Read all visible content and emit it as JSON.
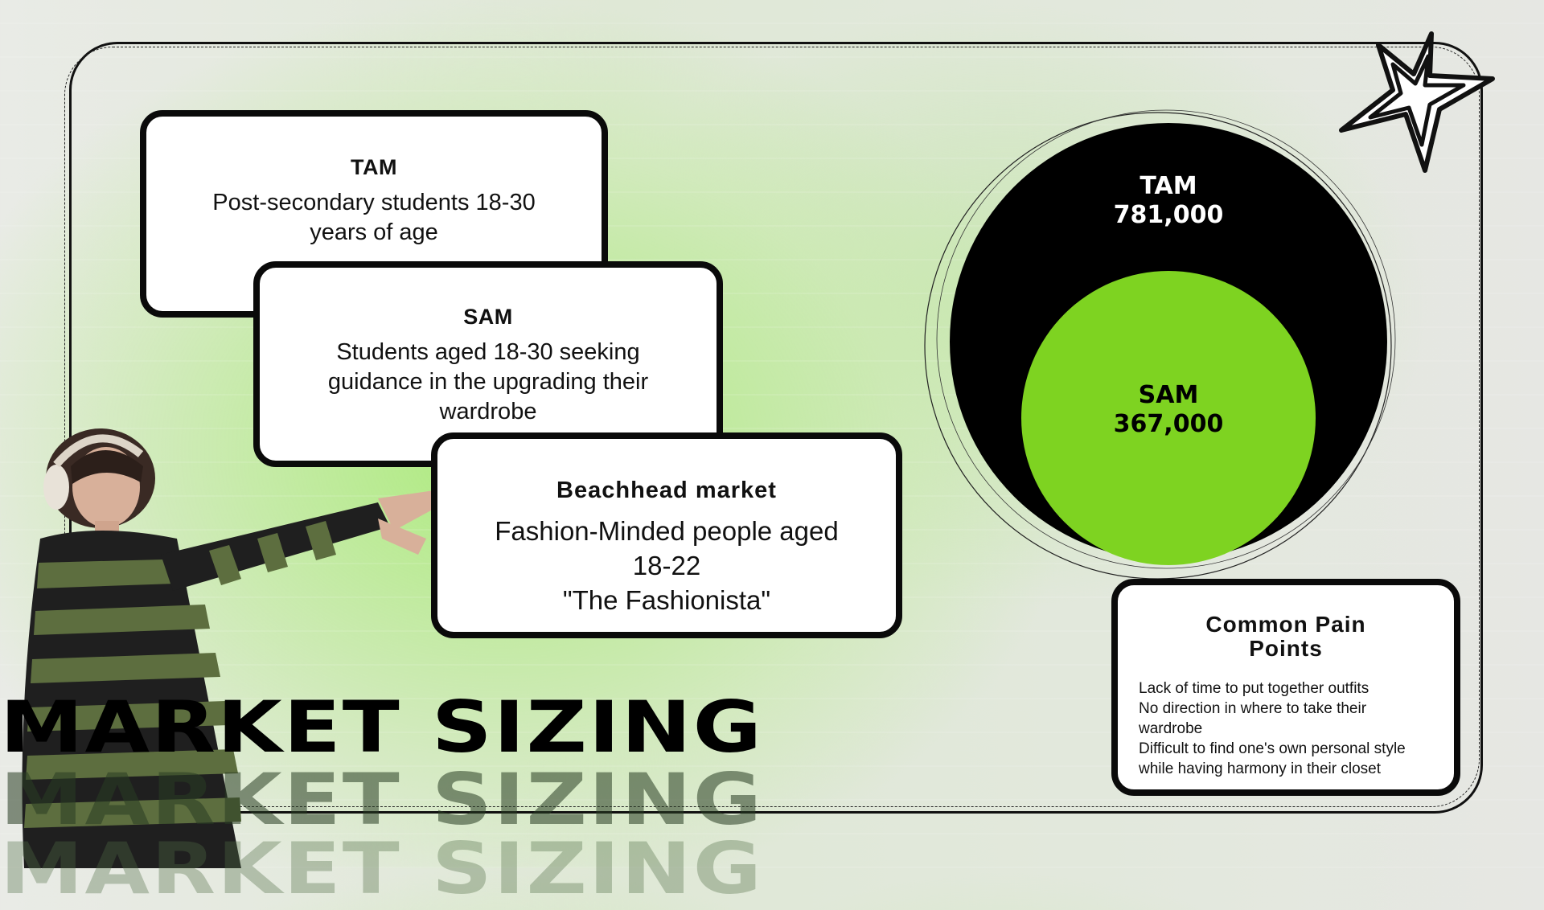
{
  "slide": {
    "headline": "MARKET SIZING"
  },
  "cards": {
    "tam": {
      "title": "TAM",
      "text": "Post-secondary students 18-30 years of age"
    },
    "sam": {
      "title": "SAM",
      "text": "Students aged 18-30 seeking guidance in the upgrading their wardrobe"
    },
    "beachhead": {
      "title": "Beachhead market",
      "line1": "Fashion-Minded people aged",
      "line2": "18-22",
      "line3": "\"The Fashionista\""
    }
  },
  "circles": {
    "tam": {
      "label": "TAM",
      "value": "781,000",
      "color": "#000000"
    },
    "sam": {
      "label": "SAM",
      "value": "367,000",
      "color": "#7ed321"
    }
  },
  "pain_points": {
    "title": "Common Pain Points",
    "items": [
      "Lack of time to put together outfits",
      "No direction in where to take their wardrobe",
      "Difficult to find one's own personal style while having harmony in their closet"
    ]
  },
  "icons": [
    "star-icon"
  ],
  "colors": {
    "accent": "#7ed321",
    "ink": "#0a0a0a"
  }
}
